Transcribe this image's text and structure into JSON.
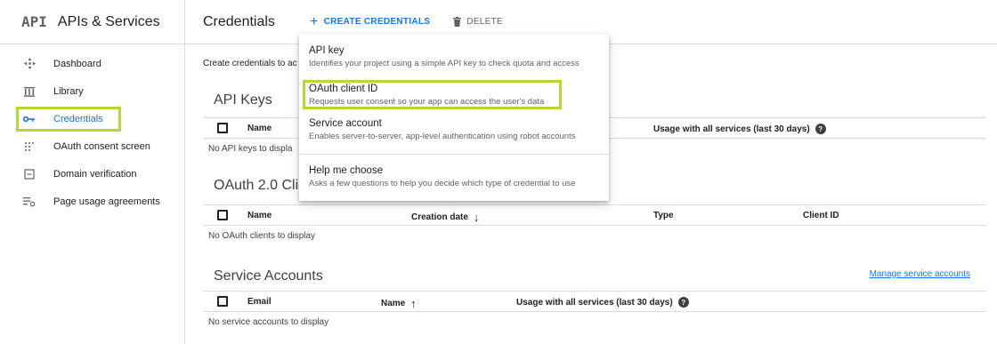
{
  "sidebar": {
    "logo": "API",
    "title": "APIs & Services",
    "items": [
      {
        "label": "Dashboard",
        "icon": "dashboard-icon"
      },
      {
        "label": "Library",
        "icon": "library-icon"
      },
      {
        "label": "Credentials",
        "icon": "key-icon",
        "active": true
      },
      {
        "label": "OAuth consent screen",
        "icon": "consent-icon"
      },
      {
        "label": "Domain verification",
        "icon": "domain-verification-icon"
      },
      {
        "label": "Page usage agreements",
        "icon": "agreements-icon"
      }
    ]
  },
  "header": {
    "title": "Credentials",
    "create_label": "CREATE CREDENTIALS",
    "delete_label": "DELETE"
  },
  "main": {
    "intro": "Create credentials to ac",
    "api_keys": {
      "title": "API Keys",
      "col_name": "Name",
      "col_usage": "Usage with all services (last 30 days)",
      "empty": "No API keys to displa"
    },
    "oauth": {
      "title": "OAuth 2.0 Clie",
      "col_name": "Name",
      "col_creation": "Creation date",
      "col_type": "Type",
      "col_client": "Client ID",
      "empty": "No OAuth clients to display"
    },
    "service_accounts": {
      "title": "Service Accounts",
      "manage_link": "Manage service accounts",
      "col_email": "Email",
      "col_name": "Name",
      "col_usage": "Usage with all services (last 30 days)",
      "empty": "No service accounts to display"
    }
  },
  "menu": {
    "items": [
      {
        "title": "API key",
        "desc": "Identifies your project using a simple API key to check quota and access"
      },
      {
        "title": "OAuth client ID",
        "desc": "Requests user consent so your app can access the user's data"
      },
      {
        "title": "Service account",
        "desc": "Enables server-to-server, app-level authentication using robot accounts"
      },
      {
        "title": "Help me choose",
        "desc": "Asks a few questions to help you decide which type of credential to use"
      }
    ]
  },
  "colors": {
    "accent": "#1a73e8",
    "highlight": "#b6d736"
  }
}
